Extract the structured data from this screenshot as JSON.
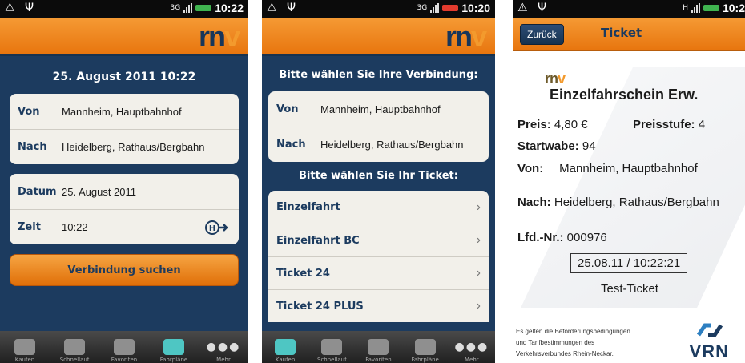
{
  "status": {
    "s1": {
      "left_icons": "⚠ Ψ",
      "network": "3G",
      "time": "10:22"
    },
    "s2": {
      "left_icons": "⚠ Ψ",
      "network": "3G",
      "time": "10:20"
    },
    "s3": {
      "left_icons": "⚠ Ψ",
      "network": "H",
      "time": "10:2"
    }
  },
  "logo": {
    "text_main": "rn",
    "text_v": "v"
  },
  "screen1": {
    "datetime_title": "25. August 2011 10:22",
    "von_label": "Von",
    "von_value": "Mannheim,  Hauptbahnhof",
    "nach_label": "Nach",
    "nach_value": "Heidelberg,  Rathaus/Bergbahn",
    "datum_label": "Datum",
    "datum_value": "25. August 2011",
    "zeit_label": "Zeit",
    "zeit_value": "10:22",
    "search_button": "Verbindung suchen"
  },
  "screen2": {
    "connection_title": "Bitte wählen Sie Ihre Verbindung:",
    "von_label": "Von",
    "von_value": "Mannheim,  Hauptbahnhof",
    "nach_label": "Nach",
    "nach_value": "Heidelberg,  Rathaus/Bergbahn",
    "ticket_title": "Bitte wählen Sie Ihr Ticket:",
    "tickets": [
      "Einzelfahrt",
      "Einzelfahrt BC",
      "Ticket 24",
      "Ticket 24 PLUS"
    ]
  },
  "screen3": {
    "back_button": "Zurück",
    "title": "Ticket",
    "ticket_name": "Einzelfahrschein Erw.",
    "preis_label": "Preis:",
    "preis_value": "4,80 €",
    "preisstufe_label": "Preisstufe:",
    "preisstufe_value": "4",
    "startwabe_label": "Startwabe:",
    "startwabe_value": "94",
    "von_label": "Von:",
    "von_value": "Mannheim, Hauptbahnhof",
    "nach_label": "Nach:",
    "nach_value": "Heidelberg, Rathaus/Bergbahn",
    "lfd_label": "Lfd.-Nr.:",
    "lfd_value": "000976",
    "stamp": "25.08.11 / 10:22:21",
    "test_label": "Test-Ticket",
    "fine_print_1": "Es gelten die Beförderungsbedingungen",
    "fine_print_2": "und Tarifbestimmungen des",
    "fine_print_3": "Verkehrsverbundes Rhein-Neckar.",
    "vrn_logo": "VRN"
  },
  "tabbar": {
    "tabs": [
      "Kaufen",
      "Schnellauf",
      "Favoriten",
      "Fahrpläne",
      "Mehr"
    ],
    "active_index": 3
  },
  "colors": {
    "brand_orange": "#f39a2d",
    "brand_navy": "#1c3b5f",
    "tab_active": "#4ec6c3"
  }
}
